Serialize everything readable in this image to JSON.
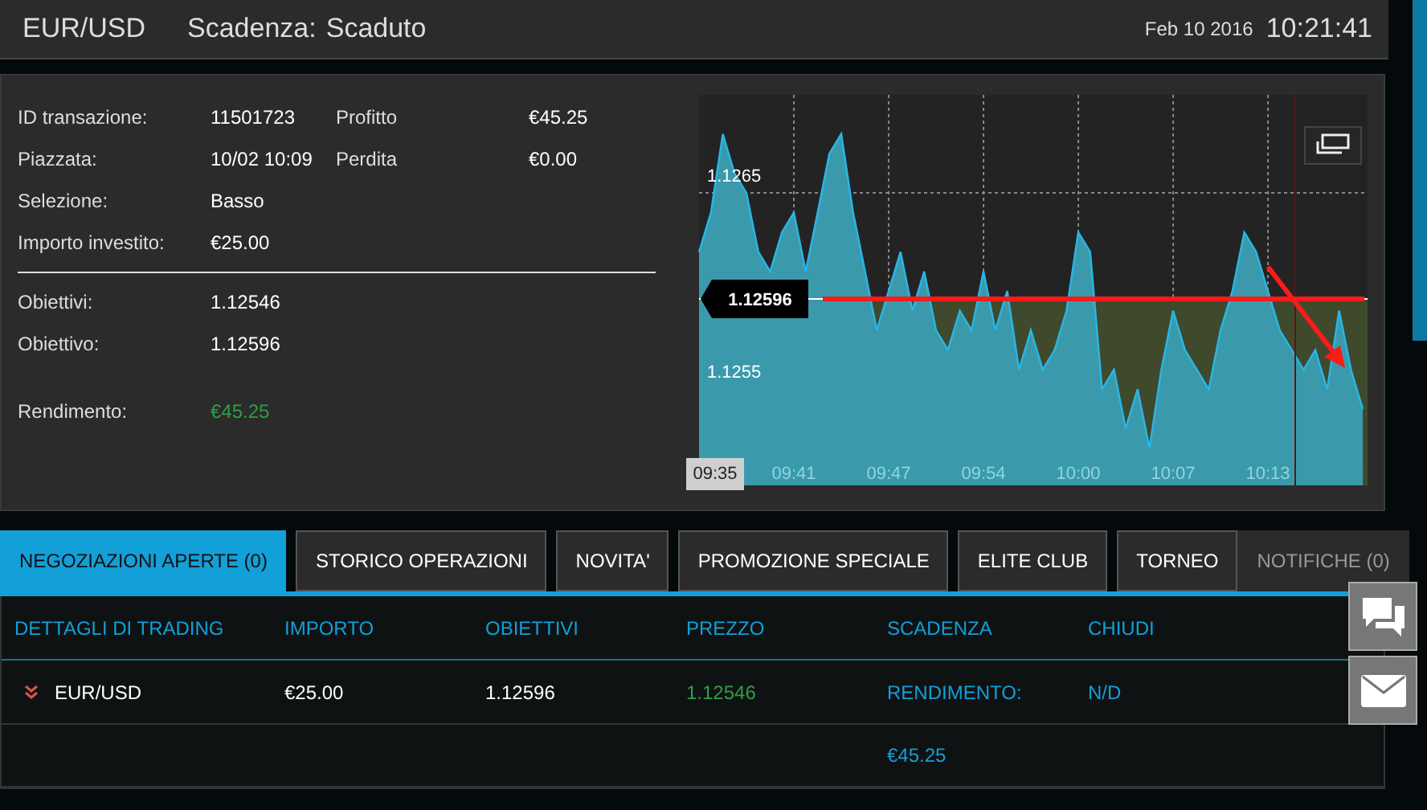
{
  "header": {
    "asset": "EUR/USD",
    "expiry_label": "Scadenza:",
    "expiry_value": "Scaduto",
    "date": "Feb 10 2016",
    "time": "10:21:41"
  },
  "details": {
    "rows": [
      {
        "label": "ID transazione:",
        "value": "11501723",
        "label_2": "Profitto",
        "value_2": "€45.25"
      },
      {
        "label": "Piazzata:",
        "value": "10/02 10:09",
        "label_2": "Perdita",
        "value_2": "€0.00"
      },
      {
        "label": "Selezione:",
        "value": "Basso"
      },
      {
        "label": "Importo investito:",
        "value": "€25.00"
      }
    ],
    "targets": [
      {
        "label": "Obiettivi:",
        "value": "1.12546"
      },
      {
        "label": "Obiettivo:",
        "value": "1.12596"
      }
    ],
    "return": {
      "label": "Rendimento:",
      "value": "€45.25",
      "positive": true
    }
  },
  "chart": {
    "current_time": "09:35",
    "chart_data": {
      "type": "area",
      "categories": [
        null,
        null,
        null,
        null,
        null,
        null,
        null,
        null,
        "09:41",
        null,
        null,
        null,
        null,
        null,
        null,
        null,
        "09:47",
        null,
        null,
        null,
        null,
        null,
        null,
        null,
        "09:54",
        null,
        null,
        null,
        null,
        null,
        null,
        null,
        "10:00",
        null,
        null,
        null,
        null,
        null,
        null,
        null,
        "10:07",
        null,
        null,
        null,
        null,
        null,
        null,
        null,
        "10:13",
        null,
        null,
        null,
        null,
        null,
        null,
        null,
        null
      ],
      "series": [
        {
          "color": "#29b6e8",
          "values": [
            1.1262,
            1.1264,
            1.1268,
            1.1266,
            1.1265,
            1.1262,
            1.1261,
            1.1263,
            1.1264,
            1.1261,
            1.1264,
            1.1267,
            1.1268,
            1.1264,
            1.1261,
            1.1258,
            1.126,
            1.1262,
            1.1259,
            1.1261,
            1.1258,
            1.1257,
            1.1259,
            1.1258,
            1.1261,
            1.1258,
            1.126,
            1.1256,
            1.1258,
            1.1256,
            1.1257,
            1.1259,
            1.1263,
            1.1262,
            1.1255,
            1.1256,
            1.1253,
            1.1255,
            1.1252,
            1.1256,
            1.1259,
            1.1257,
            1.1256,
            1.1255,
            1.1258,
            1.126,
            1.1263,
            1.1262,
            1.126,
            1.1258,
            1.1257,
            1.1256,
            1.1257,
            1.1255,
            1.1259,
            1.1256,
            1.1254
          ]
        }
      ],
      "ylim": [
        1.12501,
        1.127
      ],
      "yticks": [
        1.1255,
        1.1265
      ],
      "grid": true,
      "ref_lines": [
        {
          "axis": "y",
          "value": 1.12596,
          "label": "1.12596"
        },
        {
          "axis": "y",
          "value": 1.12596,
          "color": "#ff1a1a"
        }
      ]
    }
  },
  "tabs": [
    {
      "label": "NEGOZIAZIONI APERTE (0)",
      "selected": true,
      "disabled": false
    },
    {
      "label": "STORICO OPERAZIONI",
      "selected": false,
      "disabled": false
    },
    {
      "label": "NOVITA'",
      "selected": false,
      "disabled": false
    },
    {
      "label": "PROMOZIONE SPECIALE",
      "selected": false,
      "disabled": false
    },
    {
      "label": "ELITE CLUB",
      "selected": false,
      "disabled": false
    },
    {
      "label": "TORNEO",
      "selected": false,
      "disabled": false
    },
    {
      "label": "NOTIFICHE (0)",
      "selected": false,
      "disabled": true
    }
  ],
  "table": {
    "columns": [
      "DETTAGLI DI TRADING",
      "IMPORTO",
      "OBIETTIVI",
      "PREZZO",
      "SCADENZA",
      "CHIUDI"
    ],
    "rows": [
      {
        "falling": true,
        "asset": "EUR/USD",
        "amount": "€25.00",
        "target": "1.12596",
        "price": "1.12546",
        "expiry_label": "RENDIMENTO:",
        "close": "N/D",
        "return": "€45.25"
      }
    ]
  }
}
